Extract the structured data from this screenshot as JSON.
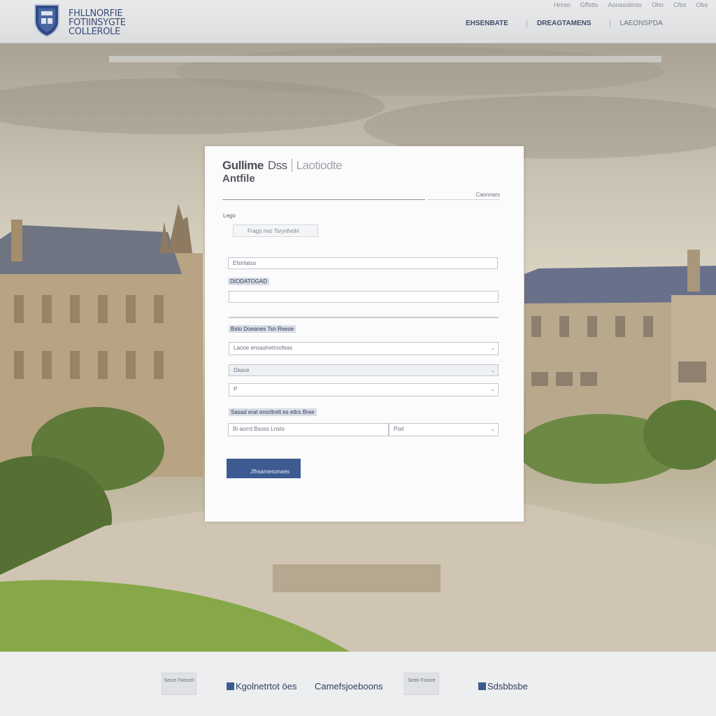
{
  "header": {
    "logo_line1": "FHLLNORFIE",
    "logo_line2": "FOTIINSYGTE",
    "logo_line3": "COLLEROLE",
    "top_links": [
      "Hnnio",
      "Gffstts",
      "Aonasstinss",
      "Ohn",
      "Cfbs",
      "Obs"
    ],
    "nav": [
      "EHSENBATE",
      "DREAGTAMENS",
      "LAEONSPDA"
    ]
  },
  "form": {
    "title_bold": "Gullime",
    "title_thin": "Dss",
    "title_faint": "Laotiodte",
    "subtitle": "Antfile",
    "meta": "Caonnars",
    "label_top": "Lego",
    "small_box": "Frags nso Tsrynfvohi",
    "field1": "Efshfatso",
    "label2": "DIODATOGAD",
    "label3": "Bsto Doeanes Tsn Reese",
    "field4": "Laooe ensaahetroofeas",
    "field5": "Dasce",
    "field6": "P",
    "label4": "Sasad erat ensrttrelt es ettrs Bree",
    "field7a": "Bi aorrd Bsoss Lnsto",
    "field7b": "Pod",
    "submit": "Jfhsamesonaes"
  },
  "footer": {
    "box1": "Sesre Fassrel",
    "link1": "Kgolnetrtot öes",
    "link2": "Camefsjoeboons",
    "box2": "Seds Fsasre",
    "link3": "Sdsbbsbe"
  },
  "colors": {
    "accent": "#3e5b91",
    "header_bg": "#e3e4e6"
  },
  "icons": [
    "crest-logo-icon"
  ]
}
